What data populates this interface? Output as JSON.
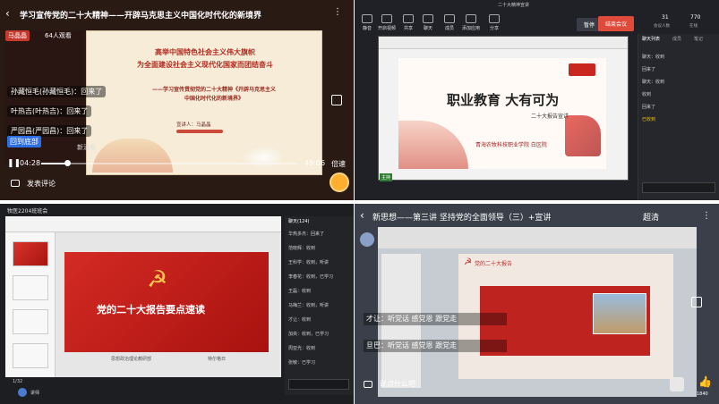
{
  "q1": {
    "title": "学习宣传党的二十大精神——开辟马克思主义中国化时代化的新境界",
    "viewer_tag": "马晶晶",
    "viewer_count": "64人观看",
    "slide_title_1": "高举中国特色社会主义伟大旗帜",
    "slide_title_2": "为全面建设社会主义现代化国家而团结奋斗",
    "slide_sub_1": "——学习宣传贯彻党的二十大精神《开辟马克思主义",
    "slide_sub_2": "中国化时代化的新境界》",
    "speaker": "宣讲人：马晶晶",
    "chat": [
      "孙藏恒毛(孙藏恒毛)：回来了",
      "叶热吉(叶热吉)：回来了",
      "严园昌(严园昌)：回来了"
    ],
    "back_to_bottom": "回到底部",
    "chat_partial": "新消息",
    "time_now": "04:28",
    "time_total": "49:06",
    "speed": "倍速",
    "comment": "发表评论"
  },
  "q2": {
    "window_title": "二十大精神宣讲",
    "toolbar": [
      "静音",
      "开启视频",
      "共享",
      "聊天",
      "成员",
      "添加应用",
      "分享"
    ],
    "end_btn": "暂停",
    "leave_btn": "结束会议",
    "stats": [
      "31",
      "770"
    ],
    "stat_labels": [
      "会议人数",
      "在线"
    ],
    "tabs": [
      "聊天列表",
      "成员",
      "笔记"
    ],
    "slide_title": "职业教育 大有可为",
    "slide_sub": "二十大报告宣讲",
    "slide_org": "青海农牧科技职业学院  白区院",
    "chat": [
      "聊天：收到",
      "回来了",
      "聊天：收到",
      "收到",
      "回来了",
      "已收到"
    ],
    "bottom_tag": "主持"
  },
  "q3": {
    "window_title": "牧医2204班班会",
    "sidebar_title": "聊天(124)",
    "slide_title": "党的二十大报告要点速读",
    "slide_org": "思想政治理论教研部",
    "slide_author": "特尔格日",
    "chat": [
      "华热多杰：回来了",
      "范晓辉：收到",
      "王科学：收到，听讲",
      "李春花：收到，已学习",
      "王磊：收到",
      "马梅兰：收到，听讲",
      "才让：收到",
      "加央：收到，已学习",
      "周亚光：收到",
      "张敏：已学习"
    ],
    "page": "1/32",
    "speaker": "讲师"
  },
  "q4": {
    "title": "新思想——第三讲 坚持党的全面领导（三）+宣讲",
    "viewer": "超清",
    "slide_tag": "党的二十大报告",
    "chat": [
      "才让：听党话 感党恩 跟党走",
      "旦巴：听党话 感党恩 跟党走"
    ],
    "input_placeholder": "说点什么吧",
    "likes": "1840"
  }
}
